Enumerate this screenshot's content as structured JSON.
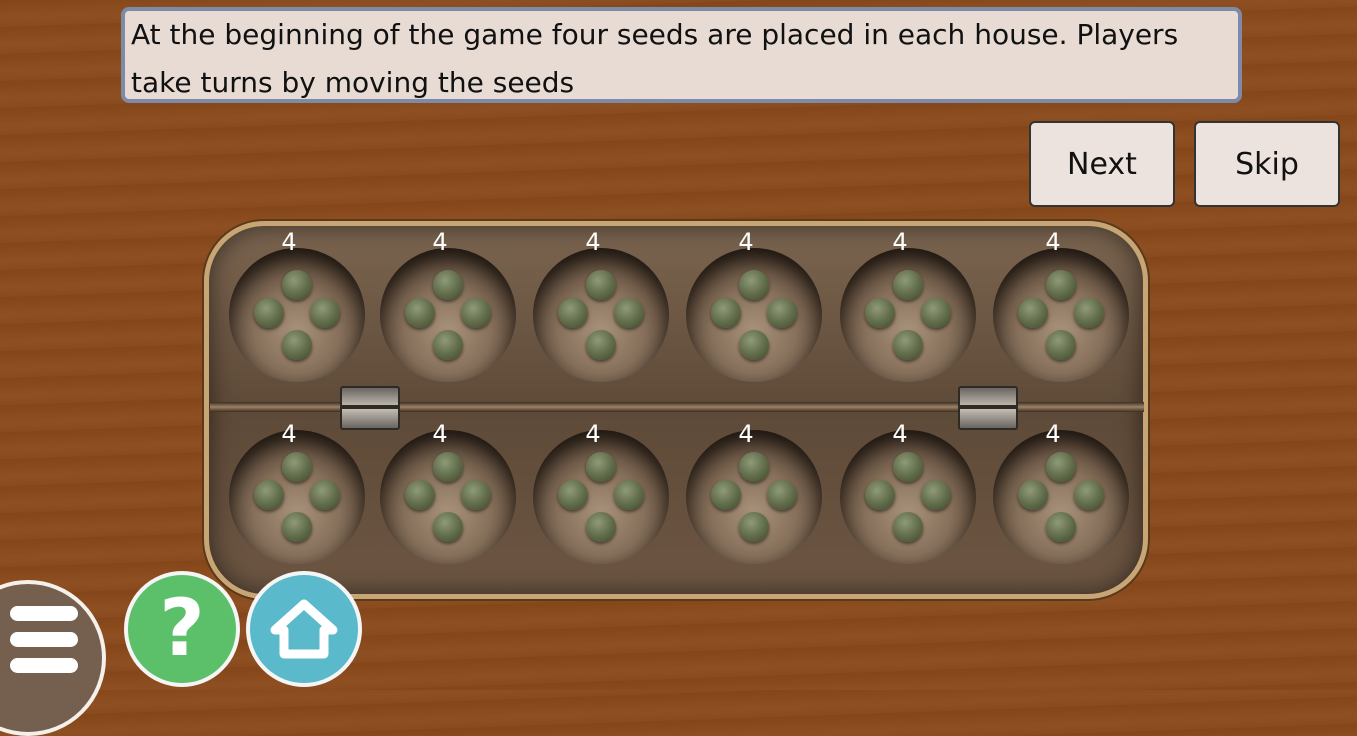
{
  "instruction": {
    "text": "At the beginning of the game four seeds are placed in each house. Players take turns by moving the seeds"
  },
  "buttons": {
    "next_label": "Next",
    "skip_label": "Skip"
  },
  "board": {
    "top_row_counts": [
      "4",
      "4",
      "4",
      "4",
      "4",
      "4"
    ],
    "bottom_row_counts": [
      "4",
      "4",
      "4",
      "4",
      "4",
      "4"
    ],
    "seed_color": "#5f6b48"
  },
  "icons": {
    "menu": "hamburger-icon",
    "help": "question-mark-icon",
    "home": "home-icon"
  },
  "colors": {
    "background": "#8a4a1c",
    "help_button": "#5cc06a",
    "home_button": "#5bb9cc",
    "menu_button": "#75604f"
  }
}
